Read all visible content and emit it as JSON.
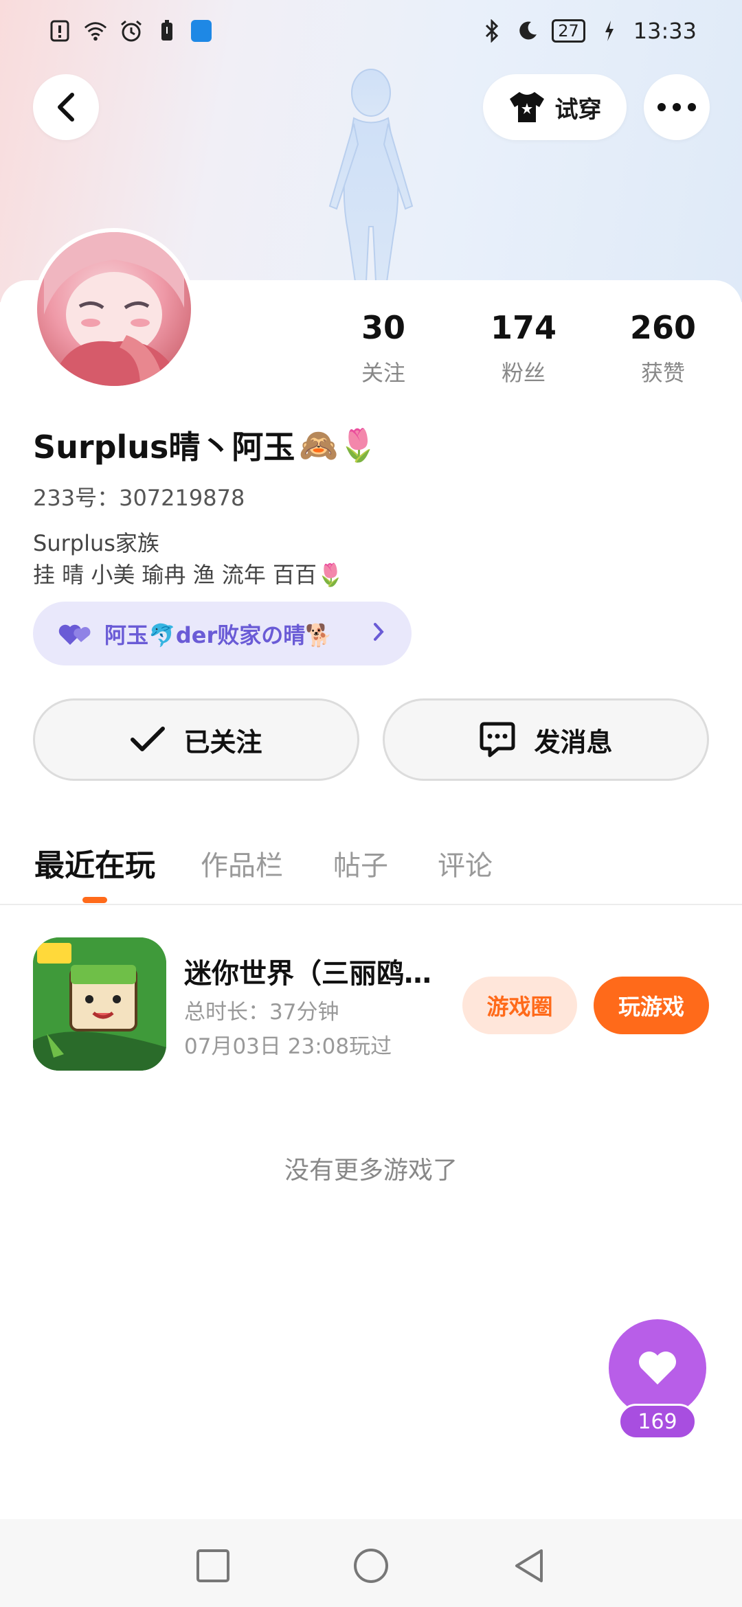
{
  "status_bar": {
    "time": "13:33",
    "battery": "27",
    "left_icons": [
      "alert-icon",
      "wifi-icon",
      "alarm-icon",
      "battery-saver-icon",
      "shield-icon"
    ],
    "right_icons": [
      "bluetooth-icon",
      "moon-icon",
      "battery-icon",
      "charging-icon"
    ]
  },
  "header": {
    "try_on_label": "试穿"
  },
  "profile": {
    "stats": [
      {
        "value": "30",
        "label": "关注"
      },
      {
        "value": "174",
        "label": "粉丝"
      },
      {
        "value": "260",
        "label": "获赞"
      }
    ],
    "username": "Surplus晴丶阿玉",
    "username_emojis": "🙈🌷",
    "uid": "233号：307219878",
    "bio_line1": "Surplus家族",
    "bio_line2": "挂 晴 小美 瑜冉 渔 流年 百百🌷",
    "family_tag": "阿玉🐬der败家の晴🐕"
  },
  "actions": {
    "follow_label": "已关注",
    "message_label": "发消息"
  },
  "tabs": [
    "最近在玩",
    "作品栏",
    "帖子",
    "评论"
  ],
  "game": {
    "title": "迷你世界（三丽鸥…",
    "duration": "总时长：37分钟",
    "last_played": "07月03日 23:08玩过",
    "circle_label": "游戏圈",
    "play_label": "玩游戏"
  },
  "no_more_text": "没有更多游戏了",
  "like": {
    "count": "169"
  },
  "colors": {
    "accent": "#ff6a1a",
    "family_tag_bg": "#e9e8fb",
    "family_tag_text": "#6a5bd6",
    "like_fab": "#b85ee8"
  }
}
